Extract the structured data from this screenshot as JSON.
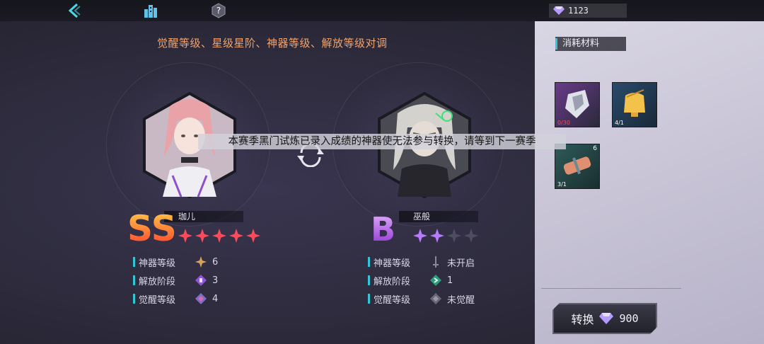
{
  "topbar": {
    "back_icon": "chevron-left-icon",
    "home_icon": "city-icon",
    "help_icon": "help-icon",
    "currency": {
      "icon": "diamond-icon",
      "value": "1123"
    }
  },
  "instruction": "觉醒等级、星级星阶、神器等级、解放等级对调",
  "left_char": {
    "name": "珈儿",
    "grade": "SS",
    "stars_filled": 5,
    "stars_total": 5,
    "stats": [
      {
        "label": "神器等级",
        "value": "6",
        "icon": "artifact-icon"
      },
      {
        "label": "解放阶段",
        "value": "3",
        "icon": "liberation-icon"
      },
      {
        "label": "觉醒等级",
        "value": "4",
        "icon": "awaken-icon"
      }
    ]
  },
  "right_char": {
    "name": "巫般",
    "grade": "B",
    "stars_filled": 2,
    "stars_total": 4,
    "stats": [
      {
        "label": "神器等级",
        "value": "未开启",
        "icon": "sword-icon"
      },
      {
        "label": "解放阶段",
        "value": "1",
        "icon": "liberation-icon"
      },
      {
        "label": "觉醒等级",
        "value": "未觉醒",
        "icon": "awaken-icon"
      }
    ]
  },
  "materials": {
    "title": "消耗材料",
    "items": [
      {
        "icon": "crystal-material-icon",
        "count": "0/30",
        "badge": ""
      },
      {
        "icon": "bell-material-icon",
        "count": "4/1",
        "badge": ""
      },
      {
        "icon": "scroll-material-icon",
        "count": "3/1",
        "badge": "6"
      }
    ]
  },
  "convert_button": {
    "label": "转换",
    "cost_icon": "diamond-icon",
    "cost": "900"
  },
  "toast": "本赛季黑门试炼已录入成绩的神器使无法参与转换，请等到下一赛季",
  "colors": {
    "accent": "#2fc7d8",
    "instruction": "#f0a36e",
    "ss_grade": "#ff5a2e",
    "b_grade": "#b34fe0",
    "star_red": "#ff4a5a",
    "star_purple": "#b67cff"
  }
}
